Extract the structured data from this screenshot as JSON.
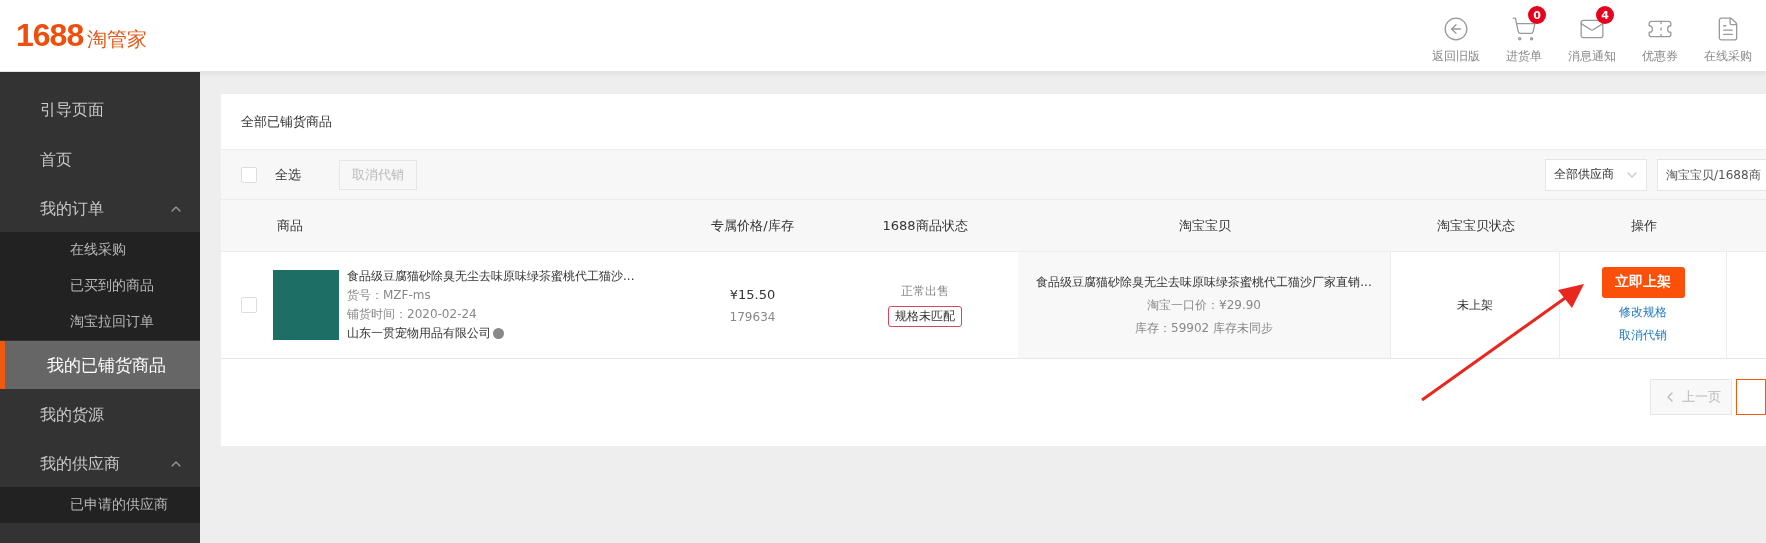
{
  "header": {
    "logo": {
      "number": "1688",
      "name": "淘管家"
    },
    "actions": [
      {
        "label": "返回旧版"
      },
      {
        "label": "进货单",
        "badge": "0"
      },
      {
        "label": "消息通知",
        "badge": "4"
      },
      {
        "label": "优惠券"
      },
      {
        "label": "在线采购"
      }
    ]
  },
  "sidebar": {
    "items": [
      {
        "label": "引导页面",
        "selected": false
      },
      {
        "label": "首页",
        "selected": false
      },
      {
        "label": "我的订单",
        "selected": false,
        "expanded": true,
        "children": [
          {
            "label": "在线采购",
            "selected": false
          },
          {
            "label": "已买到的商品",
            "selected": false
          },
          {
            "label": "淘宝拉回订单",
            "selected": false
          }
        ]
      },
      {
        "label": "我的已铺货商品",
        "selected": true
      },
      {
        "label": "我的货源",
        "selected": false
      },
      {
        "label": "我的供应商",
        "selected": false,
        "expanded": true,
        "children": [
          {
            "label": "已申请的供应商",
            "selected": false
          }
        ]
      }
    ]
  },
  "panel": {
    "title": "全部已铺货商品",
    "toolbar": {
      "select_all": {
        "label": "全选",
        "checked": false
      },
      "cancel_button": {
        "label": "取消代销",
        "disabled": true
      },
      "supplier_select": {
        "value": "全部供应商"
      },
      "search": {
        "placeholder": "淘宝宝贝/1688商"
      }
    },
    "table": {
      "columns": [
        "商品",
        "专属价格/库存",
        "1688商品状态",
        "淘宝宝贝",
        "淘宝宝贝状态",
        "操作"
      ],
      "rows": [
        {
          "checked": false,
          "product": {
            "title": "食品级豆腐猫砂除臭无尘去味原味绿茶蜜桃代工猫沙...",
            "sku": "货号：MZF-ms",
            "date": "铺货时间：2020-02-24",
            "supplier": "山东一贯宠物用品有限公司"
          },
          "price": "¥15.50",
          "stock": "179634",
          "status": "正常出售",
          "spec_tag": "规格未匹配",
          "taobao": {
            "title": "食品级豆腐猫砂除臭无尘去味原味绿茶蜜桃代工猫沙厂家直销...",
            "price": "淘宝一口价：¥29.90",
            "stock": "库存：59902 库存未同步"
          },
          "taobao_status": "未上架",
          "primary_action": "立即上架",
          "links": [
            "修改规格",
            "取消代销"
          ]
        }
      ]
    },
    "pagination": {
      "prev": {
        "label": "上一页",
        "disabled": true
      }
    }
  }
}
